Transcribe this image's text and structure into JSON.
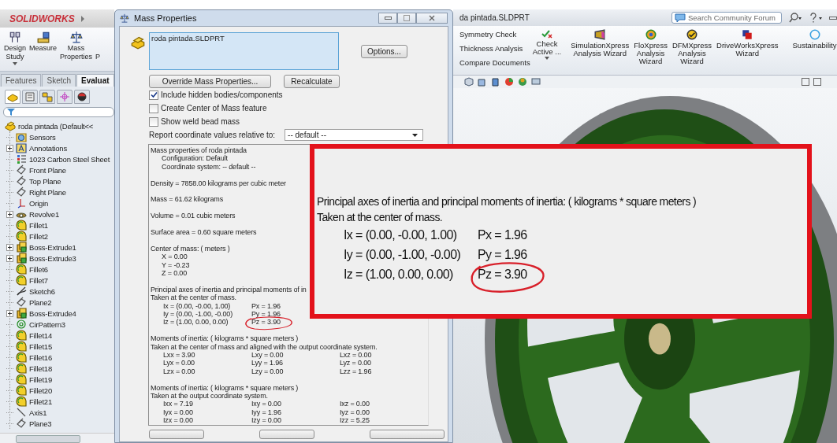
{
  "app": {
    "logo": "SOLIDWORKS",
    "document_title": "da pintada.SLDPRT",
    "search": {
      "placeholder": "Search Community Forum"
    }
  },
  "left_ribbon": [
    {
      "label": "Design\nStudy",
      "kind": "design",
      "dropdown": true
    },
    {
      "label": "Measure",
      "kind": "measure",
      "dropdown": false
    },
    {
      "label": "Mass\nProperties",
      "kind": "mass",
      "dropdown": false
    },
    {
      "label": "P",
      "kind": "cut",
      "dropdown": false
    }
  ],
  "command_tabs": [
    {
      "label": "Features",
      "selected": false
    },
    {
      "label": "Sketch",
      "selected": false
    },
    {
      "label": "Evaluat",
      "selected": true
    }
  ],
  "panel_tabs": [
    {
      "kind": "feature",
      "selected": true
    },
    {
      "kind": "property",
      "selected": false
    },
    {
      "kind": "configuration",
      "selected": false
    },
    {
      "kind": "dimxpert",
      "selected": false
    },
    {
      "kind": "display",
      "selected": false
    }
  ],
  "feature_tree": {
    "label": "roda pintada  (Default<<",
    "kind": "part",
    "children": [
      {
        "label": "Sensors",
        "kind": "sensor",
        "collapsible": false
      },
      {
        "label": "Annotations",
        "kind": "annotation",
        "collapsible": true
      },
      {
        "label": "1023 Carbon Steel Sheet",
        "kind": "material",
        "collapsible": false
      },
      {
        "label": "Front Plane",
        "kind": "plane",
        "collapsible": false
      },
      {
        "label": "Top Plane",
        "kind": "plane",
        "collapsible": false
      },
      {
        "label": "Right Plane",
        "kind": "plane",
        "collapsible": false
      },
      {
        "label": "Origin",
        "kind": "origin",
        "collapsible": false
      },
      {
        "label": "Revolve1",
        "kind": "revolve",
        "collapsible": true
      },
      {
        "label": "Fillet1",
        "kind": "fillet",
        "collapsible": false
      },
      {
        "label": "Fillet2",
        "kind": "fillet",
        "collapsible": false
      },
      {
        "label": "Boss-Extrude1",
        "kind": "extrude",
        "collapsible": true
      },
      {
        "label": "Boss-Extrude3",
        "kind": "extrude",
        "collapsible": true
      },
      {
        "label": "Fillet6",
        "kind": "fillet",
        "collapsible": false
      },
      {
        "label": "Fillet7",
        "kind": "fillet",
        "collapsible": false
      },
      {
        "label": "Sketch6",
        "kind": "sketch",
        "collapsible": false
      },
      {
        "label": "Plane2",
        "kind": "plane",
        "collapsible": false
      },
      {
        "label": "Boss-Extrude4",
        "kind": "extrude",
        "collapsible": true
      },
      {
        "label": "CirPattern3",
        "kind": "pattern",
        "collapsible": false
      },
      {
        "label": "Fillet14",
        "kind": "fillet",
        "collapsible": false
      },
      {
        "label": "Fillet15",
        "kind": "fillet",
        "collapsible": false
      },
      {
        "label": "Fillet16",
        "kind": "fillet",
        "collapsible": false
      },
      {
        "label": "Fillet18",
        "kind": "fillet",
        "collapsible": false
      },
      {
        "label": "Fillet19",
        "kind": "fillet",
        "collapsible": false
      },
      {
        "label": "Fillet20",
        "kind": "fillet",
        "collapsible": false
      },
      {
        "label": "Fillet21",
        "kind": "fillet",
        "collapsible": false
      },
      {
        "label": "Axis1",
        "kind": "axis",
        "collapsible": false
      },
      {
        "label": "Plane3",
        "kind": "plane",
        "collapsible": false
      }
    ]
  },
  "dialog": {
    "title": "Mass Properties",
    "selection": "roda pintada.SLDPRT",
    "options_button": "Options...",
    "override_button": "Override Mass Properties...",
    "recalculate_button": "Recalculate",
    "options": [
      {
        "label": "Include hidden bodies/components",
        "checked": true
      },
      {
        "label": "Create Center of Mass feature",
        "checked": false
      },
      {
        "label": "Show weld bead mass",
        "checked": false
      }
    ],
    "report_label": "Report coordinate values relative to:",
    "report_value": "-- default --",
    "results": [
      [
        {
          "kind": "heading",
          "text": "Mass properties of roda pintada"
        },
        {
          "kind": "sub",
          "text": "Configuration: Default"
        },
        {
          "kind": "sub",
          "text": "Coordinate system: -- default --"
        }
      ],
      [
        {
          "kind": "heading",
          "text": "Density = 7858.00 kilograms per cubic meter"
        }
      ],
      [
        {
          "kind": "heading",
          "text": "Mass = 61.62 kilograms"
        }
      ],
      [
        {
          "kind": "heading",
          "text": "Volume = 0.01 cubic meters"
        }
      ],
      [
        {
          "kind": "heading",
          "text": "Surface area = 0.60 square meters"
        }
      ],
      [
        {
          "kind": "heading",
          "text": "Center of mass: ( meters )"
        },
        {
          "kind": "sub",
          "text": "X = 0.00"
        },
        {
          "kind": "sub",
          "text": "Y = -0.23"
        },
        {
          "kind": "sub",
          "text": "Z = 0.00"
        }
      ],
      [
        {
          "kind": "heading",
          "text": "Principal axes of inertia and principal moments of in"
        },
        {
          "kind": "heading",
          "text": "Taken at the center of mass."
        },
        {
          "kind": "row",
          "cells": [
            {
              "text": "Ix = (0.00, -0.00, 1.00)",
              "circled": false
            },
            {
              "text": "Px = 1.96",
              "circled": false
            }
          ]
        },
        {
          "kind": "row",
          "cells": [
            {
              "text": "Iy = (0.00, -1.00, -0.00)",
              "circled": false
            },
            {
              "text": "Py = 1.96",
              "circled": false
            }
          ]
        },
        {
          "kind": "row",
          "cells": [
            {
              "text": "Iz = (1.00, 0.00, 0.00)",
              "circled": false
            },
            {
              "text": "Pz = 3.90",
              "circled": true
            }
          ]
        }
      ],
      [
        {
          "kind": "heading",
          "text": "Moments of inertia: ( kilograms * square meters )"
        },
        {
          "kind": "heading",
          "text": "Taken at the center of mass and aligned with the output coordinate system."
        },
        {
          "kind": "row",
          "cells": [
            {
              "text": "Lxx = 3.90",
              "circled": false
            },
            {
              "text": "Lxy = 0.00",
              "circled": false
            },
            {
              "text": "Lxz = 0.00",
              "circled": false
            }
          ]
        },
        {
          "kind": "row",
          "cells": [
            {
              "text": "Lyx = 0.00",
              "circled": false
            },
            {
              "text": "Lyy = 1.96",
              "circled": false
            },
            {
              "text": "Lyz = 0.00",
              "circled": false
            }
          ]
        },
        {
          "kind": "row",
          "cells": [
            {
              "text": "Lzx = 0.00",
              "circled": false
            },
            {
              "text": "Lzy = 0.00",
              "circled": false
            },
            {
              "text": "Lzz = 1.96",
              "circled": false
            }
          ]
        }
      ],
      [
        {
          "kind": "heading",
          "text": "Moments of inertia: ( kilograms * square meters )"
        },
        {
          "kind": "heading",
          "text": "Taken at the output coordinate system."
        },
        {
          "kind": "row",
          "cells": [
            {
              "text": "Ixx = 7.19",
              "circled": false
            },
            {
              "text": "Ixy = 0.00",
              "circled": false
            },
            {
              "text": "Ixz = 0.00",
              "circled": false
            }
          ]
        },
        {
          "kind": "row",
          "cells": [
            {
              "text": "Iyx = 0.00",
              "circled": false
            },
            {
              "text": "Iyy = 1.96",
              "circled": false
            },
            {
              "text": "Iyz = 0.00",
              "circled": false
            }
          ]
        },
        {
          "kind": "row",
          "cells": [
            {
              "text": "Izx = 0.00",
              "circled": false
            },
            {
              "text": "Izy = 0.00",
              "circled": false
            },
            {
              "text": "Izz = 5.25",
              "circled": false
            }
          ]
        }
      ]
    ]
  },
  "analysis_commands": [
    "Symmetry Check",
    "Thickness Analysis",
    "Compare Documents"
  ],
  "check_active": {
    "label": "Check\nActive ...",
    "dropdown": true
  },
  "wizards": [
    {
      "label": "SimulationXpress\nAnalysis Wizard",
      "kind": "simulation"
    },
    {
      "label": "FloXpress\nAnalysis\nWizard",
      "kind": "flow"
    },
    {
      "label": "DFMXpress\nAnalysis\nWizard",
      "kind": "dfm"
    },
    {
      "label": "DriveWorksXpress\nWizard",
      "kind": "driveworks"
    },
    {
      "label": "Sustainability",
      "kind": "sustainability"
    }
  ],
  "magnified_inset": {
    "lines": [
      {
        "kind": "heading",
        "text": "Principal axes of inertia and principal moments of inertia: ( kilograms * square meters )"
      },
      {
        "kind": "heading",
        "text": "Taken at the center of mass."
      },
      {
        "kind": "row",
        "cells": [
          {
            "text": "Ix = (0.00, -0.00, 1.00)",
            "circled": false
          },
          {
            "text": "Px = 1.96",
            "circled": false
          }
        ]
      },
      {
        "kind": "row",
        "cells": [
          {
            "text": "Iy = (0.00, -1.00, -0.00)",
            "circled": false
          },
          {
            "text": "Py = 1.96",
            "circled": false
          }
        ]
      },
      {
        "kind": "row",
        "cells": [
          {
            "text": "Iz = (1.00, 0.00, 0.00)",
            "circled": false
          },
          {
            "text": "Pz = 3.90",
            "circled": true
          }
        ]
      }
    ]
  }
}
